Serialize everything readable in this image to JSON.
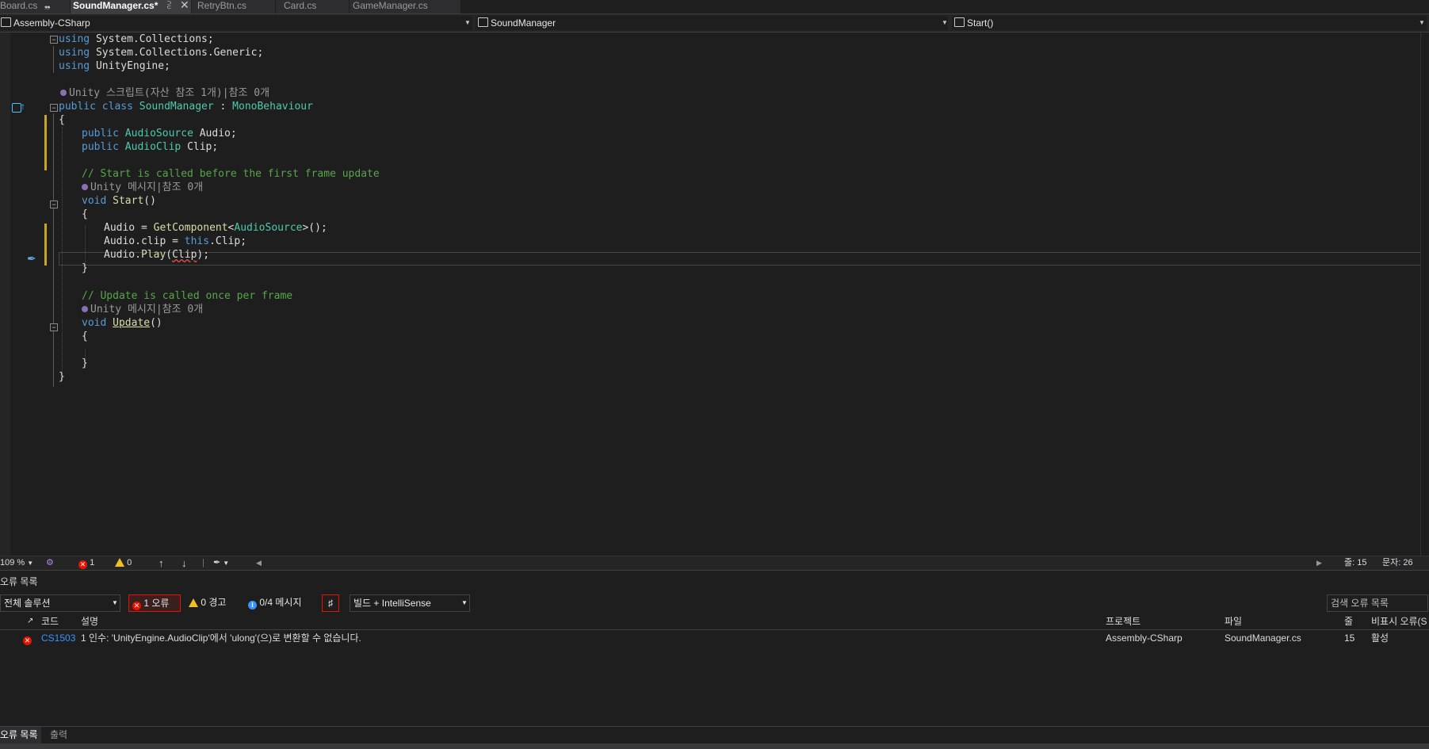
{
  "tabs": [
    {
      "label": "Board.cs",
      "pin": "❠"
    },
    {
      "label": "SoundManager.cs*",
      "pin": "⫔",
      "close": "✕"
    },
    {
      "label": "RetryBtn.cs"
    },
    {
      "label": "Card.cs"
    },
    {
      "label": "GameManager.cs"
    }
  ],
  "navbar": {
    "project": "Assembly-CSharp",
    "type": "SoundManager",
    "member": "Start()"
  },
  "code": {
    "line1_kw": "using",
    "line1_rest": " System.Collections;",
    "line2_kw": "using",
    "line2_rest": " System.Collections.Generic;",
    "line3_kw": "using",
    "line3_rest": " UnityEngine;",
    "lens_class": "Unity 스크립트(자산 참조 1개)|참조 0개",
    "class_public": "public",
    "class_kw": "class",
    "class_name": "SoundManager",
    "class_colon": " : ",
    "class_base": "MonoBehaviour",
    "open_brace": "{",
    "close_brace": "}",
    "field1_kw": "public",
    "field1_type": "AudioSource",
    "field1_name": " Audio;",
    "field2_kw": "public",
    "field2_type": "AudioClip",
    "field2_name": " Clip;",
    "comment_start": "// Start is called before the first frame update",
    "lens_start": "Unity 메시지|참조 0개",
    "start_kw": "void",
    "start_name": "Start",
    "start_parens": "()",
    "s1_a": "Audio = ",
    "s1_method": "GetComponent",
    "s1_lt": "<",
    "s1_type": "AudioSource",
    "s1_rest": ">();",
    "s2_a": "Audio.clip = ",
    "s2_this": "this",
    "s2_rest": ".Clip;",
    "s3_a": "Audio.",
    "s3_method": "Play",
    "s3_open": "(",
    "s3_arg": "Clip",
    "s3_close": ");",
    "comment_update": "// Update is called once per frame",
    "lens_update": "Unity 메시지|참조 0개",
    "update_kw": "void",
    "update_name": "Update",
    "update_parens": "()"
  },
  "editor_status": {
    "zoom": "109 %",
    "errors": "1",
    "warnings": "0",
    "line": "줄: 15",
    "col": "문자: 26"
  },
  "error_list": {
    "title": "오류 목록",
    "scope": "전체 솔루션",
    "errors_btn": "1 오류",
    "warnings_btn": "0 경고",
    "messages_btn": "0/4 메시지",
    "build_filter": "빌드 + IntelliSense",
    "search_placeholder": "검색 오류 목록",
    "headers": {
      "code": "코드",
      "desc": "설명",
      "project": "프로젝트",
      "file": "파일",
      "line": "줄",
      "suppress": "비표시 오류(S"
    },
    "rows": [
      {
        "code": "CS1503",
        "desc": "1 인수: 'UnityEngine.AudioClip'에서 'ulong'(으)로 변환할 수 없습니다.",
        "project": "Assembly-CSharp",
        "file": "SoundManager.cs",
        "line": "15",
        "state": "활성"
      }
    ]
  },
  "bottom_tabs": [
    "오류 목록",
    "출력"
  ],
  "colors": {
    "keyword": "#569cd6",
    "type": "#4ec9b0",
    "comment": "#57a64a",
    "method": "#dcdcaa",
    "error": "#e51400"
  }
}
